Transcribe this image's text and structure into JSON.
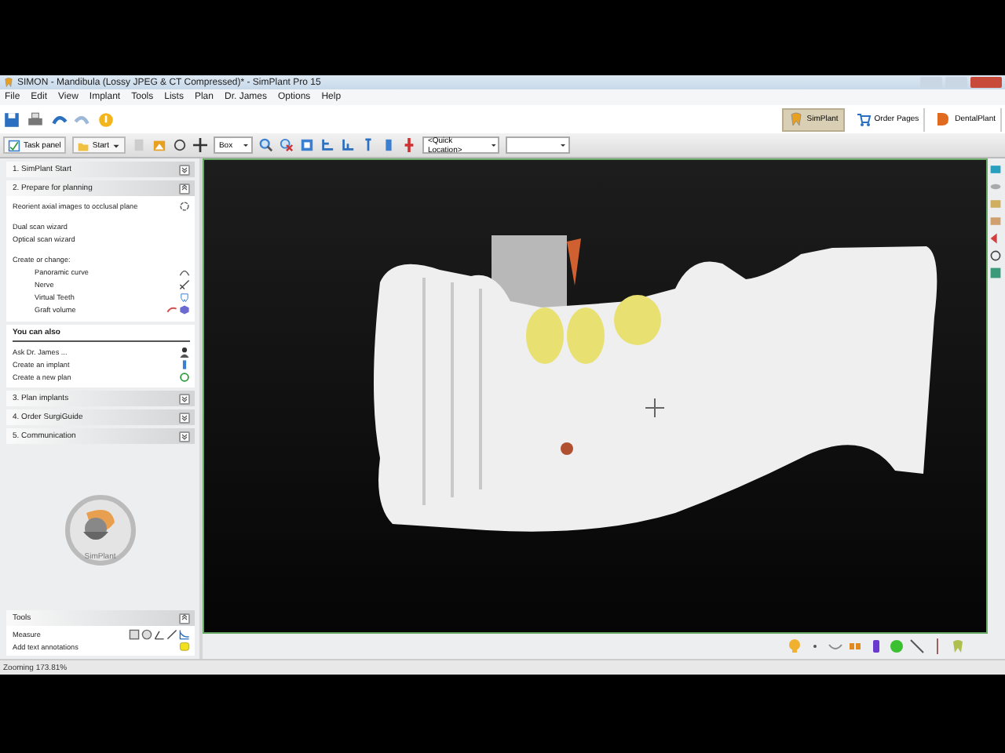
{
  "window": {
    "title": "SIMON - Mandibula (Lossy JPEG & CT Compressed)* - SimPlant Pro 15"
  },
  "menu": [
    {
      "label": "File"
    },
    {
      "label": "Edit"
    },
    {
      "label": "View"
    },
    {
      "label": "Implant"
    },
    {
      "label": "Tools"
    },
    {
      "label": "Lists"
    },
    {
      "label": "Plan"
    },
    {
      "label": "Dr. James"
    },
    {
      "label": "Options"
    },
    {
      "label": "Help"
    }
  ],
  "modules": [
    {
      "label": "SimPlant",
      "selected": true
    },
    {
      "label": "Order Pages",
      "selected": false
    },
    {
      "label": "DentalPlant",
      "selected": false
    }
  ],
  "toolbar": {
    "task_panel": "Task panel",
    "start": "Start",
    "box_select": "Box",
    "quick_location": "<Quick Location>"
  },
  "task_panel": {
    "sections": [
      {
        "title": "1. SimPlant Start",
        "expanded": false
      },
      {
        "title": "2. Prepare for planning",
        "expanded": true,
        "groups": [
          [
            {
              "text": "Reorient axial images to occlusal plane"
            }
          ],
          [
            {
              "text": "Dual scan wizard"
            },
            {
              "text": "Optical scan wizard"
            }
          ],
          [
            {
              "text": "Create or change:",
              "children": [
                {
                  "text": "Panoramic curve"
                },
                {
                  "text": "Nerve"
                },
                {
                  "text": "Virtual Teeth"
                },
                {
                  "text": "Graft volume"
                }
              ]
            }
          ]
        ]
      }
    ],
    "also": {
      "title": "You can also",
      "items": [
        {
          "text": "Ask Dr. James ..."
        },
        {
          "text": "Create an implant"
        },
        {
          "text": "Create a new plan"
        }
      ]
    },
    "more_sections": [
      {
        "title": "3. Plan implants",
        "expanded": false
      },
      {
        "title": "4. Order SurgiGuide",
        "expanded": false
      },
      {
        "title": "5. Communication",
        "expanded": false
      }
    ],
    "logo": "SimPlant",
    "tools": {
      "title": "Tools",
      "expanded": true,
      "items": [
        {
          "text": "Measure"
        },
        {
          "text": "Add text annotations"
        }
      ]
    }
  },
  "status_bar": {
    "text": "Zooming 173.81%"
  }
}
